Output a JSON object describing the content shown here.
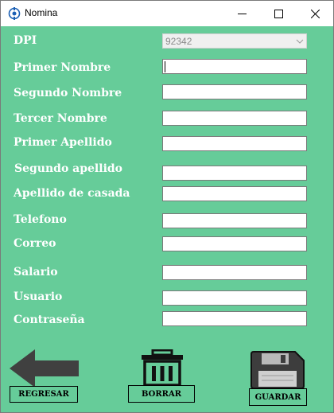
{
  "window": {
    "title": "Nomina"
  },
  "form": {
    "dpi_label": "DPI",
    "dpi_value": "92342",
    "fields": [
      {
        "label": "Primer Nombre",
        "value": ""
      },
      {
        "label": "Segundo Nombre",
        "value": ""
      },
      {
        "label": "Tercer Nombre",
        "value": ""
      },
      {
        "label": "Primer Apellido",
        "value": ""
      },
      {
        "label": "Segundo apellido",
        "value": ""
      },
      {
        "label": "Apellido de casada",
        "value": ""
      },
      {
        "label": "Telefono",
        "value": ""
      },
      {
        "label": "Correo",
        "value": ""
      },
      {
        "label": "Salario",
        "value": ""
      },
      {
        "label": "Usuario",
        "value": ""
      },
      {
        "label": "Contraseña",
        "value": ""
      }
    ]
  },
  "buttons": {
    "back_label": "REGRESAR",
    "delete_label": "BORRAR",
    "save_label": "GUARDAR"
  },
  "icons": {
    "back": "arrow-left-icon",
    "delete": "trash-icon",
    "save": "floppy-disk-icon"
  },
  "colors": {
    "background": "#66cc99",
    "label_text": "#ffffff"
  }
}
